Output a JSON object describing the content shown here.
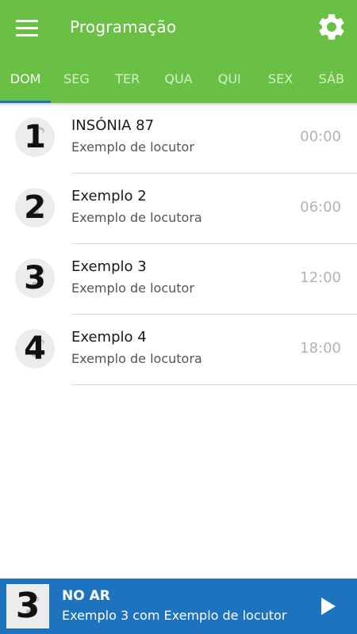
{
  "header": {
    "title": "Programação",
    "menu_icon": "hamburger-menu-icon",
    "settings_icon": "gear-icon"
  },
  "tabs": [
    {
      "label": "DOM",
      "active": true
    },
    {
      "label": "SEG",
      "active": false
    },
    {
      "label": "TER",
      "active": false
    },
    {
      "label": "QUA",
      "active": false
    },
    {
      "label": "QUI",
      "active": false
    },
    {
      "label": "SEX",
      "active": false
    },
    {
      "label": "SÁB",
      "active": false
    }
  ],
  "schedule": [
    {
      "number": "1",
      "title": "INSÓNIA 87",
      "host": "Exemplo de locutor",
      "time": "00:00"
    },
    {
      "number": "2",
      "title": "Exemplo 2",
      "host": "Exemplo de locutora",
      "time": "06:00"
    },
    {
      "number": "3",
      "title": "Exemplo 3",
      "host": "Exemplo de locutor",
      "time": "12:00"
    },
    {
      "number": "4",
      "title": "Exemplo 4",
      "host": "Exemplo de locutora",
      "time": "18:00"
    }
  ],
  "player": {
    "label": "NO AR",
    "now_playing": "Exemplo 3 com Exemplo de locutor",
    "number": "3",
    "play_icon": "play-icon"
  },
  "colors": {
    "appbar": "#6ac045",
    "tab_indicator": "#1e73be",
    "player_bar": "#1e73be"
  }
}
